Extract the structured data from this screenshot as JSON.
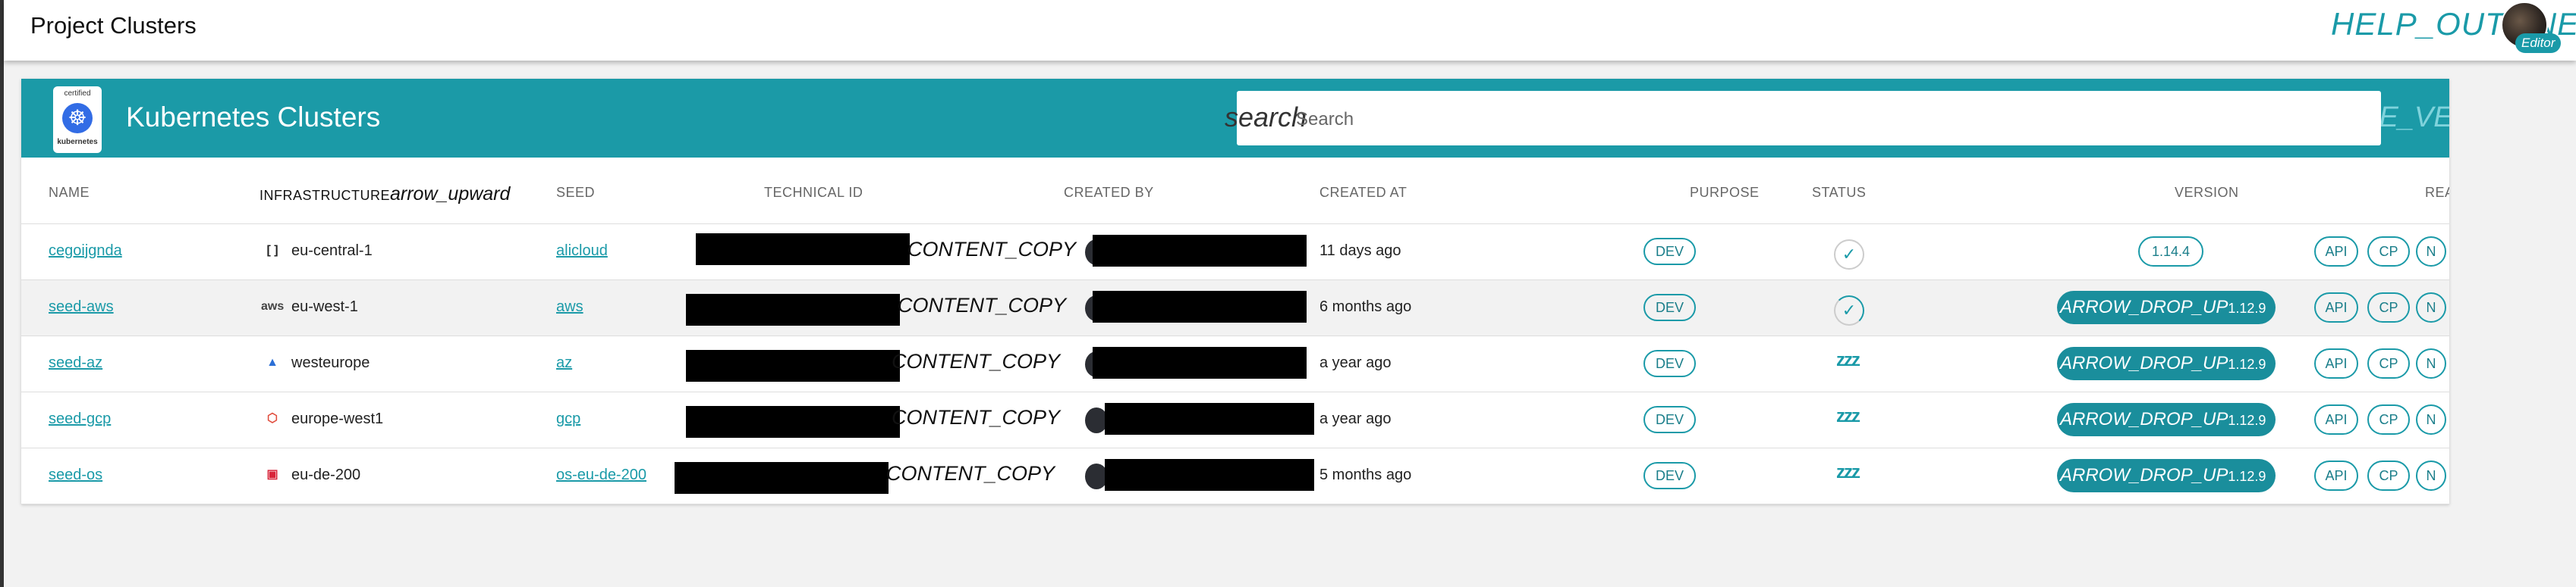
{
  "app": {
    "title": "Project Clusters",
    "help": "HELP_OUTLINE",
    "avatar_badge": "Editor"
  },
  "card": {
    "title": "Kubernetes Clusters",
    "logo": {
      "certified": "certified",
      "name": "kubernetes"
    },
    "search_icon": "search",
    "search_placeholder": "Search",
    "header_cut_text": "RE_VERT"
  },
  "columns": {
    "name": "NAME",
    "infrastructure": "INFRASTRUCTURE",
    "sort_icon": "arrow_upward",
    "seed": "SEED",
    "technical_id": "TECHNICAL ID",
    "created_by": "CREATED BY",
    "created_at": "CREATED AT",
    "purpose": "PURPOSE",
    "status": "STATUS",
    "version": "VERSION",
    "ready": "REA"
  },
  "copy_label": "CONTENT_COPY",
  "buttons": {
    "api": "API",
    "cp": "CP",
    "n": "N"
  },
  "rows": [
    {
      "name": "cegoijgnda",
      "provider_icon": "alibaba-icon",
      "provider_glyph": "[ ]",
      "region": "eu-central-1",
      "seed": "alicloud",
      "created_at": "11 days ago",
      "purpose": "DEV",
      "status": "running",
      "version_arrow": "",
      "version": "1.14.4"
    },
    {
      "name": "seed-aws",
      "provider_icon": "aws-icon",
      "provider_glyph": "aws",
      "region": "eu-west-1",
      "seed": "aws",
      "created_at": "6 months ago",
      "purpose": "DEV",
      "status": "progressing",
      "version_arrow": "ARROW_DROP_UP",
      "version": "1.12.9"
    },
    {
      "name": "seed-az",
      "provider_icon": "azure-icon",
      "provider_glyph": "▲",
      "region": "westeurope",
      "seed": "az",
      "created_at": "a year ago",
      "purpose": "DEV",
      "status": "hibernated",
      "version_arrow": "ARROW_DROP_UP",
      "version": "1.12.9"
    },
    {
      "name": "seed-gcp",
      "provider_icon": "gcp-icon",
      "provider_glyph": "⬡",
      "region": "europe-west1",
      "seed": "gcp",
      "created_at": "a year ago",
      "purpose": "DEV",
      "status": "hibernated",
      "version_arrow": "ARROW_DROP_UP",
      "version": "1.12.9"
    },
    {
      "name": "seed-os",
      "provider_icon": "openstack-icon",
      "provider_glyph": "▣",
      "region": "eu-de-200",
      "seed": "os-eu-de-200",
      "created_at": "5 months ago",
      "purpose": "DEV",
      "status": "hibernated",
      "version_arrow": "ARROW_DROP_UP",
      "version": "1.12.9"
    }
  ],
  "status_glyphs": {
    "running": "✓",
    "progressing": "✓",
    "hibernated": "zzz"
  },
  "colors": {
    "accent": "#1b9aa7",
    "text": "#222222"
  }
}
